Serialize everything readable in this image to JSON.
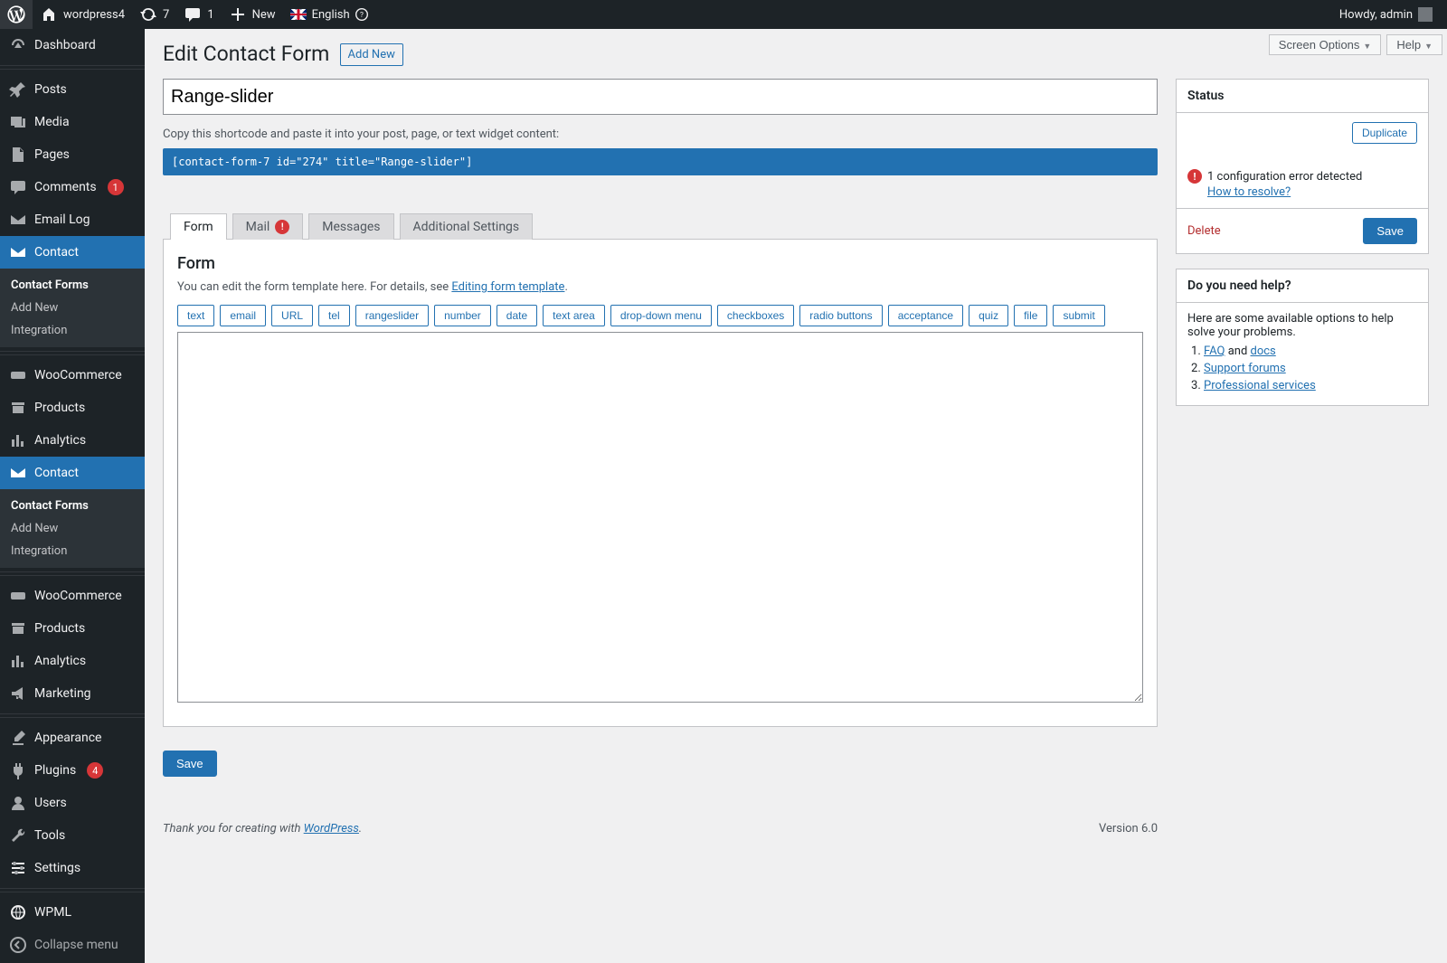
{
  "toolbar": {
    "site_name": "wordpress4",
    "updates_count": "7",
    "comments_count": "1",
    "new_label": "New",
    "language_label": "English",
    "howdy": "Howdy, admin"
  },
  "screen_options_label": "Screen Options",
  "help_label": "Help",
  "admin_menu": {
    "dashboard": "Dashboard",
    "posts": "Posts",
    "media": "Media",
    "pages": "Pages",
    "comments": "Comments",
    "comments_count": "1",
    "email_log": "Email Log",
    "contact": "Contact",
    "woocommerce": "WooCommerce",
    "products": "Products",
    "analytics": "Analytics",
    "marketing": "Marketing",
    "appearance": "Appearance",
    "plugins": "Plugins",
    "plugins_count": "4",
    "users": "Users",
    "tools": "Tools",
    "settings": "Settings",
    "wpml": "WPML",
    "collapse": "Collapse menu",
    "contact_sub": {
      "forms": "Contact Forms",
      "add_new": "Add New",
      "integration": "Integration"
    }
  },
  "page": {
    "heading": "Edit Contact Form",
    "add_new": "Add New",
    "form_title": "Range-slider",
    "shortcode_hint": "Copy this shortcode and paste it into your post, page, or text widget content:",
    "shortcode": "[contact-form-7 id=\"274\" title=\"Range-slider\"]"
  },
  "tabs": {
    "form": "Form",
    "mail": "Mail",
    "messages": "Messages",
    "additional": "Additional Settings"
  },
  "form_panel": {
    "title": "Form",
    "hint_prefix": "You can edit the form template here. For details, see ",
    "hint_link": "Editing form template",
    "tags": [
      "text",
      "email",
      "URL",
      "tel",
      "rangeslider",
      "number",
      "date",
      "text area",
      "drop-down menu",
      "checkboxes",
      "radio buttons",
      "acceptance",
      "quiz",
      "file",
      "submit"
    ],
    "textarea_value": ""
  },
  "save_label": "Save",
  "status_box": {
    "title": "Status",
    "duplicate": "Duplicate",
    "error_text": "1 configuration error detected",
    "resolve_link": "How to resolve?",
    "delete": "Delete",
    "save": "Save"
  },
  "help_box": {
    "title": "Do you need help?",
    "intro": "Here are some available options to help solve your problems.",
    "items": {
      "faq": "FAQ",
      "and": " and ",
      "docs": "docs",
      "support": "Support forums",
      "pro": "Professional services"
    }
  },
  "footer": {
    "thank_you_prefix": "Thank you for creating with ",
    "wp_link": "WordPress",
    "version": "Version 6.0"
  }
}
